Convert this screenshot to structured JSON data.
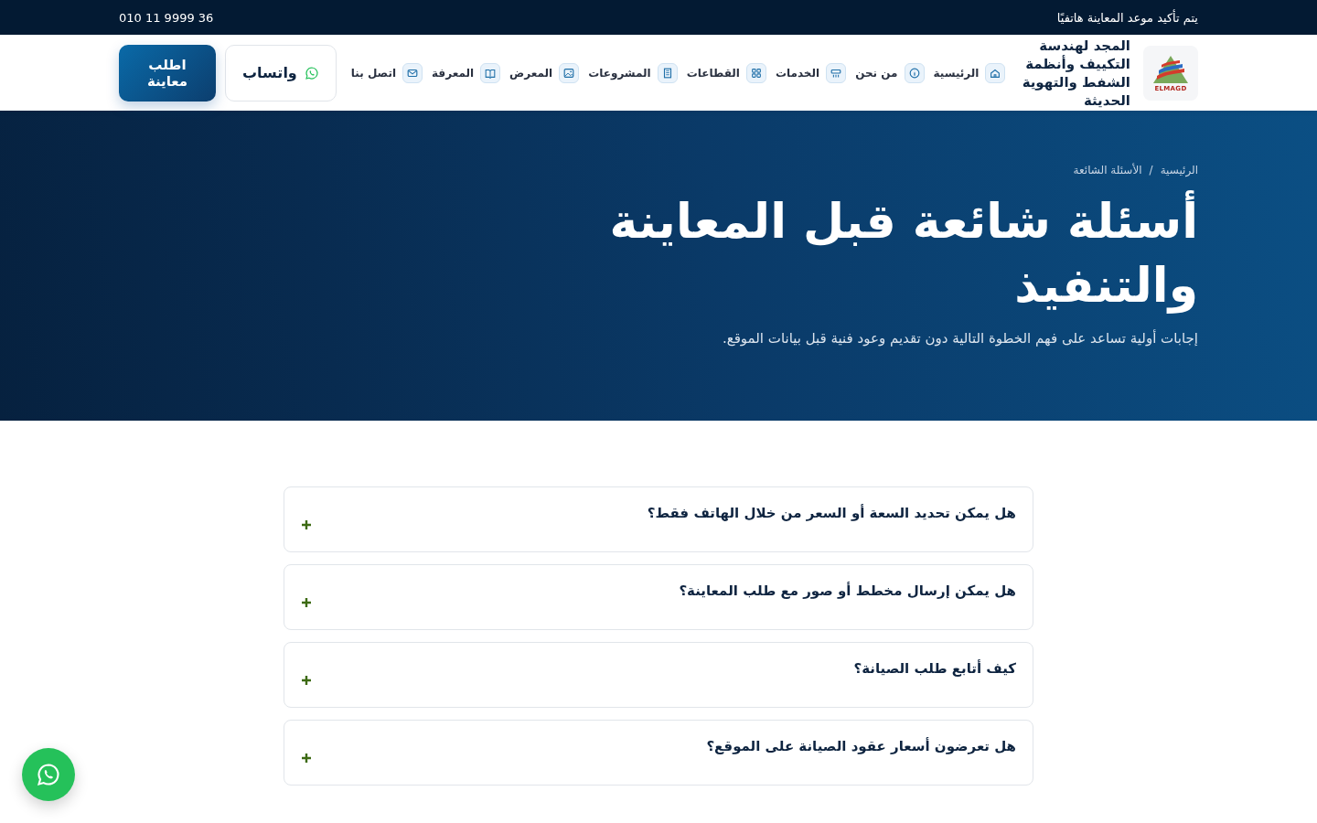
{
  "top_bar": {
    "notice": "يتم تأكيد موعد المعاينة هاتفيًا",
    "phone": "010 11 9999 36"
  },
  "header": {
    "logo_text": "ELMAGD",
    "brand": "المجد لهندسة التكييف وأنظمة الشفط والتهوية الحديثة",
    "nav": [
      {
        "label": "الرئيسية"
      },
      {
        "label": "من نحن"
      },
      {
        "label": "الخدمات"
      },
      {
        "label": "القطاعات"
      },
      {
        "label": "المشروعات"
      },
      {
        "label": "المعرض"
      },
      {
        "label": "المعرفة"
      },
      {
        "label": "اتصل بنا"
      }
    ],
    "whatsapp_button": "واتساب",
    "cta_button": "اطلب معاينة"
  },
  "hero": {
    "breadcrumb": [
      "الرئيسية",
      "الأسئلة الشائعة"
    ],
    "breadcrumb_separator": "/",
    "title": "أسئلة شائعة قبل المعاينة والتنفيذ",
    "subtitle": "إجابات أولية تساعد على فهم الخطوة التالية دون تقديم وعود فنية قبل بيانات الموقع."
  },
  "faq": [
    {
      "question": "هل يمكن تحديد السعة أو السعر من خلال الهاتف فقط؟",
      "expanded": false
    },
    {
      "question": "هل يمكن إرسال مخطط أو صور مع طلب المعاينة؟",
      "expanded": false
    },
    {
      "question": "كيف أتابع طلب الصيانة؟",
      "expanded": false
    },
    {
      "question": "هل تعرضون أسعار عقود الصيانة على الموقع؟",
      "expanded": false
    }
  ]
}
